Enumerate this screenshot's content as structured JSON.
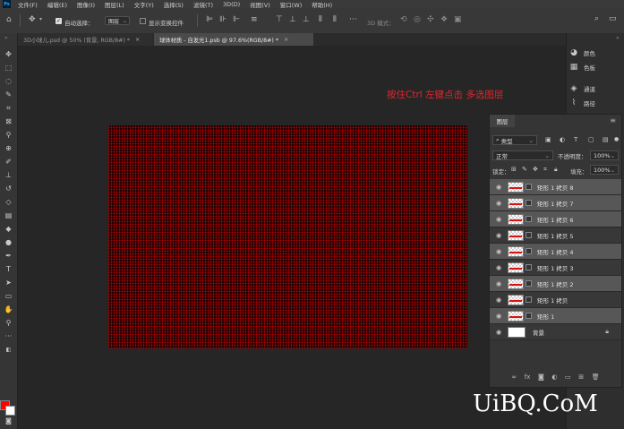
{
  "app": {
    "logo": "Ps"
  },
  "menu": [
    "文件(F)",
    "编辑(E)",
    "图像(I)",
    "图层(L)",
    "文字(Y)",
    "选择(S)",
    "滤镜(T)",
    "3D(D)",
    "视图(V)",
    "窗口(W)",
    "帮助(H)"
  ],
  "options": {
    "auto_select_label": "自动选择：",
    "auto_select_target": "图层",
    "show_transform_label": "显示变换控件",
    "mode_3d_label": "3D 模式："
  },
  "tabs": [
    {
      "label": "3D小球儿.psd @ 50% (背景, RGB/8#) *",
      "active": false
    },
    {
      "label": "球体材质 - 自发光1.psb @ 97.6%(RGB/8#) *",
      "active": true
    }
  ],
  "canvas": {
    "hint": "按住Ctrl 左键点击 多选图层",
    "hint_color": "#e0262e",
    "pattern_color": "#c80000"
  },
  "right_strip": {
    "items": [
      {
        "icon": "color-icon",
        "label": "颜色"
      },
      {
        "icon": "swatches-icon",
        "label": "色板"
      },
      {
        "icon": "channels-icon",
        "label": "通道"
      },
      {
        "icon": "paths-icon",
        "label": "路径"
      }
    ]
  },
  "layers_panel": {
    "tab": "图层",
    "kind": "类型",
    "blend_mode": "正常",
    "opacity_label": "不透明度：",
    "opacity": "100%",
    "lock_label": "锁定：",
    "fill_label": "填充：",
    "fill": "100%",
    "layers": [
      {
        "name": "矩形 1 拷贝 8",
        "selected": true,
        "thumb": "rect"
      },
      {
        "name": "矩形 1 拷贝 7",
        "selected": true,
        "thumb": "rect"
      },
      {
        "name": "矩形 1 拷贝 6",
        "selected": true,
        "thumb": "rect"
      },
      {
        "name": "矩形 1 拷贝 5",
        "selected": false,
        "thumb": "rect"
      },
      {
        "name": "矩形 1 拷贝 4",
        "selected": true,
        "thumb": "rect"
      },
      {
        "name": "矩形 1 拷贝 3",
        "selected": false,
        "thumb": "rect"
      },
      {
        "name": "矩形 1 拷贝 2",
        "selected": true,
        "thumb": "rect"
      },
      {
        "name": "矩形 1 拷贝",
        "selected": false,
        "thumb": "rect"
      },
      {
        "name": "矩形 1",
        "selected": true,
        "thumb": "rect"
      },
      {
        "name": "背景",
        "selected": false,
        "thumb": "white",
        "locked": true
      }
    ]
  },
  "colors": {
    "foreground": "#ff0000",
    "background": "#ffffff"
  },
  "watermark": "UiBQ.CoM"
}
